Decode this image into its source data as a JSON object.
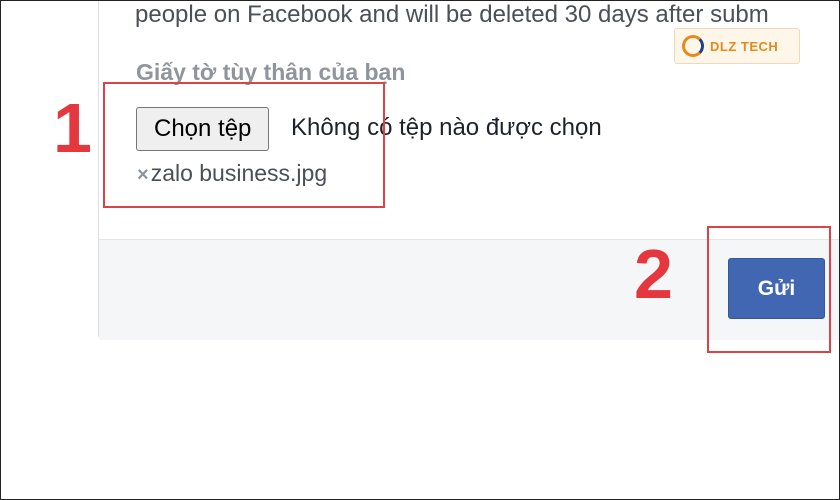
{
  "form": {
    "description": "people on Facebook and will be deleted 30 days after subm",
    "id_label": "Giấy tờ tùy thân của bạn",
    "choose_file_label": "Chọn tệp",
    "no_file_text": "Không có tệp nào được chọn",
    "attached_file_name": "zalo business.jpg",
    "remove_icon": "×",
    "submit_label": "Gửi"
  },
  "annotations": {
    "step_1": "1",
    "step_2": "2"
  },
  "watermark": {
    "brand": "DLZ TECH"
  },
  "colors": {
    "accent_button": "#4267b2",
    "annotation_red": "#d9434a"
  }
}
